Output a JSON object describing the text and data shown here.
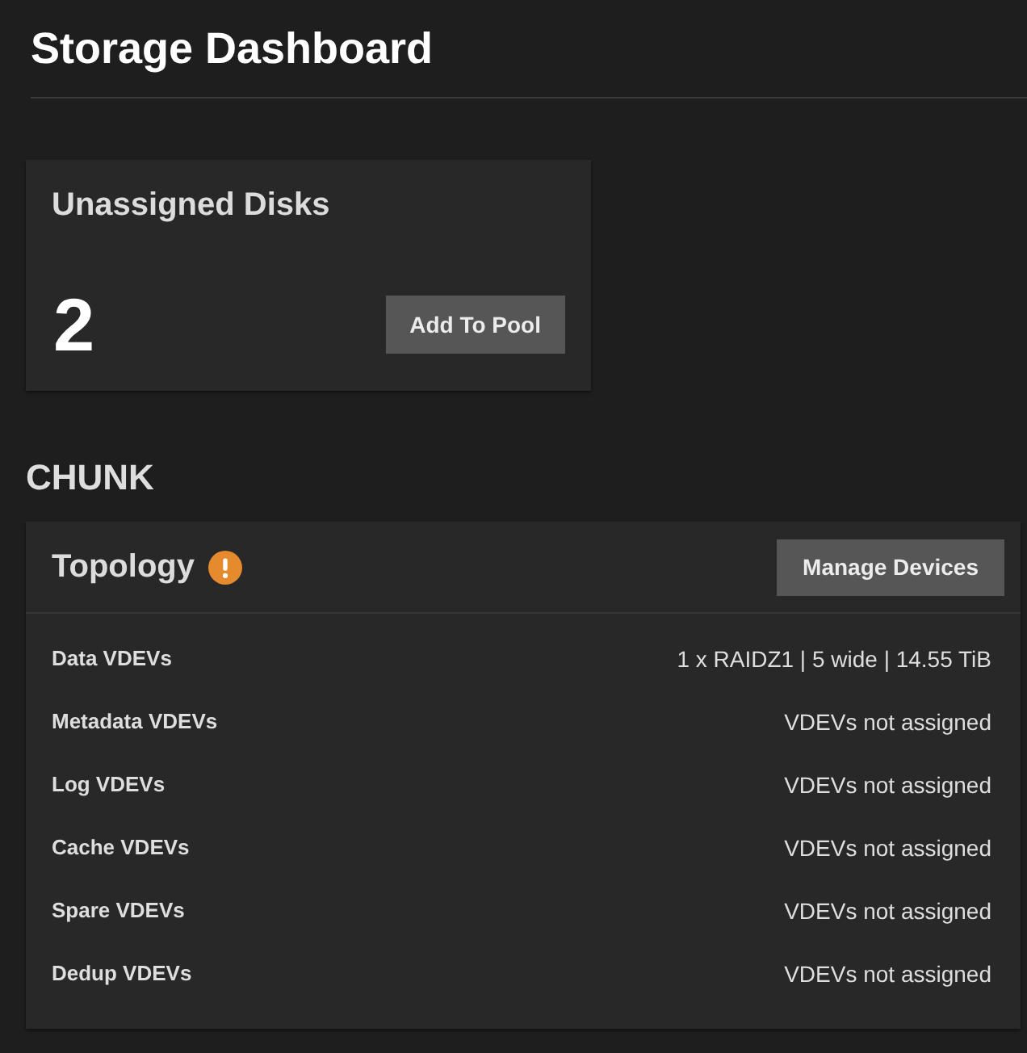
{
  "page": {
    "title": "Storage Dashboard"
  },
  "unassigned_disks": {
    "title": "Unassigned Disks",
    "count": "2",
    "button": "Add To Pool"
  },
  "pool": {
    "name": "CHUNK",
    "topology": {
      "title": "Topology",
      "warning": true,
      "button": "Manage Devices",
      "rows": [
        {
          "label": "Data VDEVs",
          "value": "1 x RAIDZ1 | 5 wide | 14.55 TiB"
        },
        {
          "label": "Metadata VDEVs",
          "value": "VDEVs not assigned"
        },
        {
          "label": "Log VDEVs",
          "value": "VDEVs not assigned"
        },
        {
          "label": "Cache VDEVs",
          "value": "VDEVs not assigned"
        },
        {
          "label": "Spare VDEVs",
          "value": "VDEVs not assigned"
        },
        {
          "label": "Dedup VDEVs",
          "value": "VDEVs not assigned"
        }
      ]
    }
  }
}
